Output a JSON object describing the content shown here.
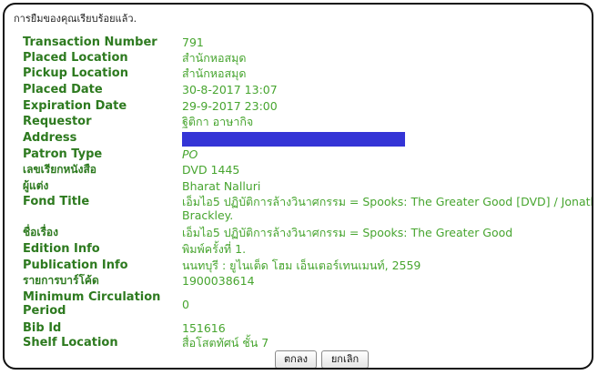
{
  "banner": "การยืมของคุณเรียบร้อยแล้ว.",
  "fields": [
    {
      "label": "Transaction Number",
      "value": "791"
    },
    {
      "label": "Placed Location",
      "value": "สำนักหอสมุด"
    },
    {
      "label": "Pickup Location",
      "value": "สำนักหอสมุด"
    },
    {
      "label": "Placed Date",
      "value": "30-8-2017 13:07"
    },
    {
      "label": "Expiration Date",
      "value": "29-9-2017 23:00"
    },
    {
      "label": "Requestor",
      "value": "ฐิติกา อาษากิจ"
    },
    {
      "label": "Address",
      "value": ""
    },
    {
      "label": "Patron Type",
      "value": "PO"
    },
    {
      "label": "เลขเรียกหนังสือ",
      "value": "DVD 1445"
    },
    {
      "label": "ผู้แต่ง",
      "value": "Bharat Nalluri"
    },
    {
      "label": "Fond Title",
      "value": "เอ็มไอ5 ปฏิบัติการล้างวินาศกรรม = Spooks: The Greater Good [DVD] / Jonathan Brackley."
    },
    {
      "label": "ชื่อเรื่อง",
      "value": "เอ็มไอ5 ปฏิบัติการล้างวินาศกรรม = Spooks: The Greater Good"
    },
    {
      "label": "Edition Info",
      "value": "พิมพ์ครั้งที่ 1."
    },
    {
      "label": "Publication Info",
      "value": "นนทบุรี : ยูไนเต็ด โฮม เอ็นเตอร์เทนเมนท์, 2559"
    },
    {
      "label": "รายการบาร์โค้ด",
      "value": "1900038614"
    },
    {
      "label": "Minimum Circulation Period",
      "value": "0"
    },
    {
      "label": "Bib Id",
      "value": "151616"
    },
    {
      "label": "Shelf Location",
      "value": "สื่อโสตทัศน์ ชั้น 7"
    }
  ],
  "buttons": {
    "ok": "ตกลง",
    "cancel": "ยกเลิก"
  },
  "colors": {
    "label": "#2d7a1f",
    "value": "#47a52f",
    "redaction": "#3434d6"
  }
}
